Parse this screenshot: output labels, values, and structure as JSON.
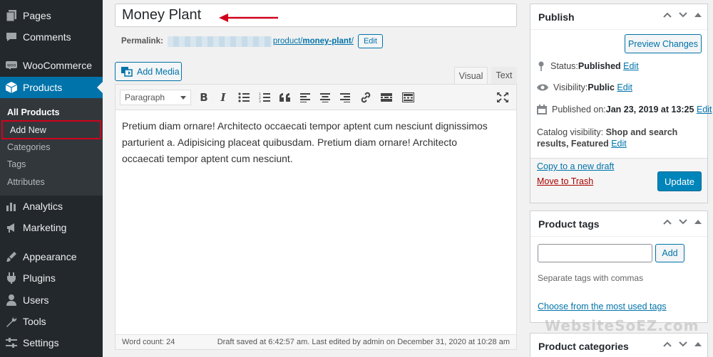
{
  "sidebar": {
    "items": [
      {
        "label": "Pages",
        "icon": "pages-icon"
      },
      {
        "label": "Comments",
        "icon": "comments-icon"
      },
      {
        "label": "WooCommerce",
        "icon": "woocommerce-icon"
      },
      {
        "label": "Products",
        "icon": "products-icon"
      },
      {
        "label": "Analytics",
        "icon": "analytics-icon"
      },
      {
        "label": "Marketing",
        "icon": "marketing-icon"
      },
      {
        "label": "Appearance",
        "icon": "appearance-icon"
      },
      {
        "label": "Plugins",
        "icon": "plugins-icon"
      },
      {
        "label": "Users",
        "icon": "users-icon"
      },
      {
        "label": "Tools",
        "icon": "tools-icon"
      },
      {
        "label": "Settings",
        "icon": "settings-icon"
      }
    ],
    "submenu": [
      "All Products",
      "Add New",
      "Categories",
      "Tags",
      "Attributes"
    ],
    "accent": "#0073aa"
  },
  "editor": {
    "title_value": "Money Plant",
    "permalink_label": "Permalink:",
    "permalink_path": "product/",
    "permalink_slug": "money-plant",
    "permalink_tail": "/",
    "permalink_edit": "Edit",
    "add_media": "Add Media",
    "tab_visual": "Visual",
    "tab_text": "Text",
    "format_select": "Paragraph",
    "content": "Pretium diam ornare! Architecto occaecati tempor aptent cum nesciunt dignissimos parturient a. Adipisicing placeat quibusdam. Pretium diam ornare! Architecto occaecati tempor aptent cum nesciunt.",
    "word_count": "Word count: 24",
    "saved_status": "Draft saved at 6:42:57 am. Last edited by admin on December 31, 2020 at 10:28 am"
  },
  "publish": {
    "title": "Publish",
    "preview": "Preview Changes",
    "status_label": "Status: ",
    "status_value": "Published",
    "visibility_label": "Visibility: ",
    "visibility_value": "Public",
    "published_label": "Published on: ",
    "published_value": "Jan 23, 2019 at 13:25",
    "edit": "Edit",
    "catalog_label": "Catalog visibility: ",
    "catalog_value": "Shop and search results, Featured",
    "copy_draft": "Copy to a new draft",
    "trash": "Move to Trash",
    "update": "Update"
  },
  "tags_box": {
    "title": "Product tags",
    "add": "Add",
    "note": "Separate tags with commas",
    "choose": "Choose from the most used tags"
  },
  "categories_box": {
    "title": "Product categories"
  },
  "watermark": "WebsiteSoEZ.com",
  "annotation_color": "#d0021b"
}
